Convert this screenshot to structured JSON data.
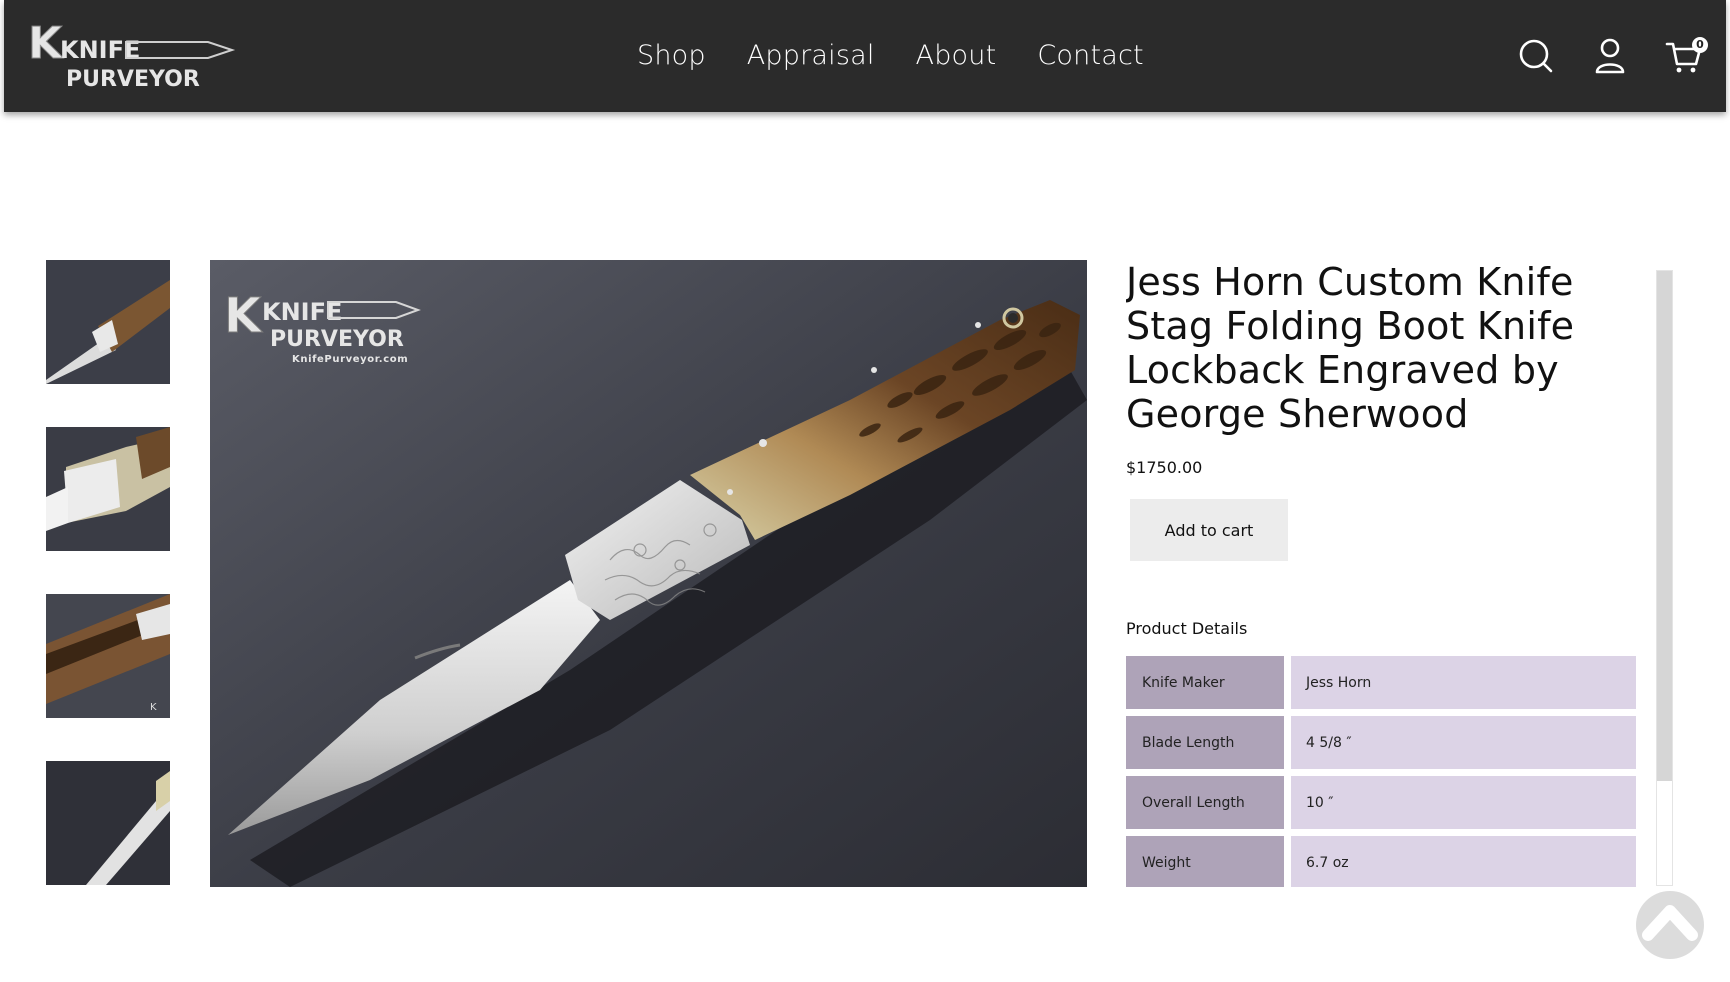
{
  "header": {
    "logo": {
      "line1": "KNIFE",
      "line2": "PURVEYOR",
      "icon": "knife-purveyor-logo"
    },
    "nav": [
      {
        "label": "Shop"
      },
      {
        "label": "Appraisal"
      },
      {
        "label": "About"
      },
      {
        "label": "Contact"
      }
    ],
    "icons": {
      "search": "search-icon",
      "account": "user-icon",
      "cart": "cart-icon"
    },
    "cart_count": "0"
  },
  "gallery": {
    "thumbnails": [
      {
        "alt": "Knife thumbnail 1"
      },
      {
        "alt": "Knife thumbnail 2"
      },
      {
        "alt": "Knife thumbnail 3"
      },
      {
        "alt": "Knife thumbnail 4"
      }
    ],
    "main_image": {
      "watermark_line1": "KNIFE",
      "watermark_line2": "PURVEYOR",
      "watermark_url": "KnifePurveyor.com"
    }
  },
  "product": {
    "title": "Jess Horn Custom Knife Stag Folding Boot Knife Lockback Engraved by George Sherwood",
    "price": "$1750.00",
    "add_to_cart": "Add to cart",
    "details_heading": "Product Details",
    "details": [
      {
        "key": "Knife Maker",
        "value": "Jess Horn"
      },
      {
        "key": "Blade Length",
        "value": "4 5/8 ″"
      },
      {
        "key": "Overall Length",
        "value": "10 ″"
      },
      {
        "key": "Weight",
        "value": "6.7 oz"
      }
    ]
  },
  "colors": {
    "header_bg": "#2b2b2b",
    "detail_key_bg": "#aea3b8",
    "detail_value_bg": "#dcd3e6",
    "button_bg": "#ececec"
  }
}
